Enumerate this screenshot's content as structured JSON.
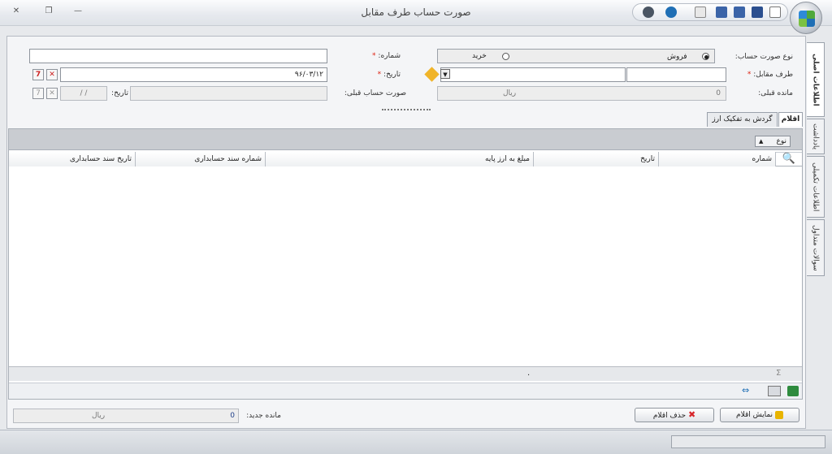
{
  "window": {
    "title": "صورت حساب طرف مقابل",
    "close_glyph": "✕",
    "restore_glyph": "❐",
    "minimize_glyph": "—"
  },
  "form": {
    "invoice_type_label": "نوع صورت حساب:",
    "option_sell": "فروش",
    "option_buy": "خرید",
    "number_label": "شماره:",
    "counterparty_label": "طرف مقابل:",
    "date_label": "تاریخ:",
    "date_value": "۹۶/۰۳/۱۲",
    "prev_balance_label": "مانده قبلی:",
    "prev_balance_value": "0",
    "prev_balance_currency": "ریال",
    "prev_invoice_label": "صورت حساب قبلی:",
    "prev_date_label": "تاریخ:",
    "prev_date_value": "/ /",
    "required_mark": "*"
  },
  "side_tabs": [
    {
      "label": "اطلاعات اصلی"
    },
    {
      "label": "یادداشت"
    },
    {
      "label": "اطلاعات تکمیلی"
    },
    {
      "label": "سوالات متداول"
    }
  ],
  "inner_tabs": [
    {
      "label": "اقلام"
    },
    {
      "label": "گردش به تفکیک ارز"
    }
  ],
  "grid": {
    "group_chip": "نوع",
    "columns": [
      "شماره",
      "تاریخ",
      "مبلغ به ارز پایه",
      "شماره سند حسابداری",
      "تاریخ سند حسابداری"
    ],
    "footer_sum": "Σ",
    "footer_dot": "."
  },
  "bottom": {
    "new_balance_label": "مانده جدید:",
    "new_balance_value": "0",
    "new_balance_currency": "ریال",
    "show_items_button": "نمایش اقلام",
    "delete_items_button": "حذف اقلام"
  },
  "colors": {
    "delete_red": "#d7262b",
    "accent_blue": "#1f6fb5"
  }
}
